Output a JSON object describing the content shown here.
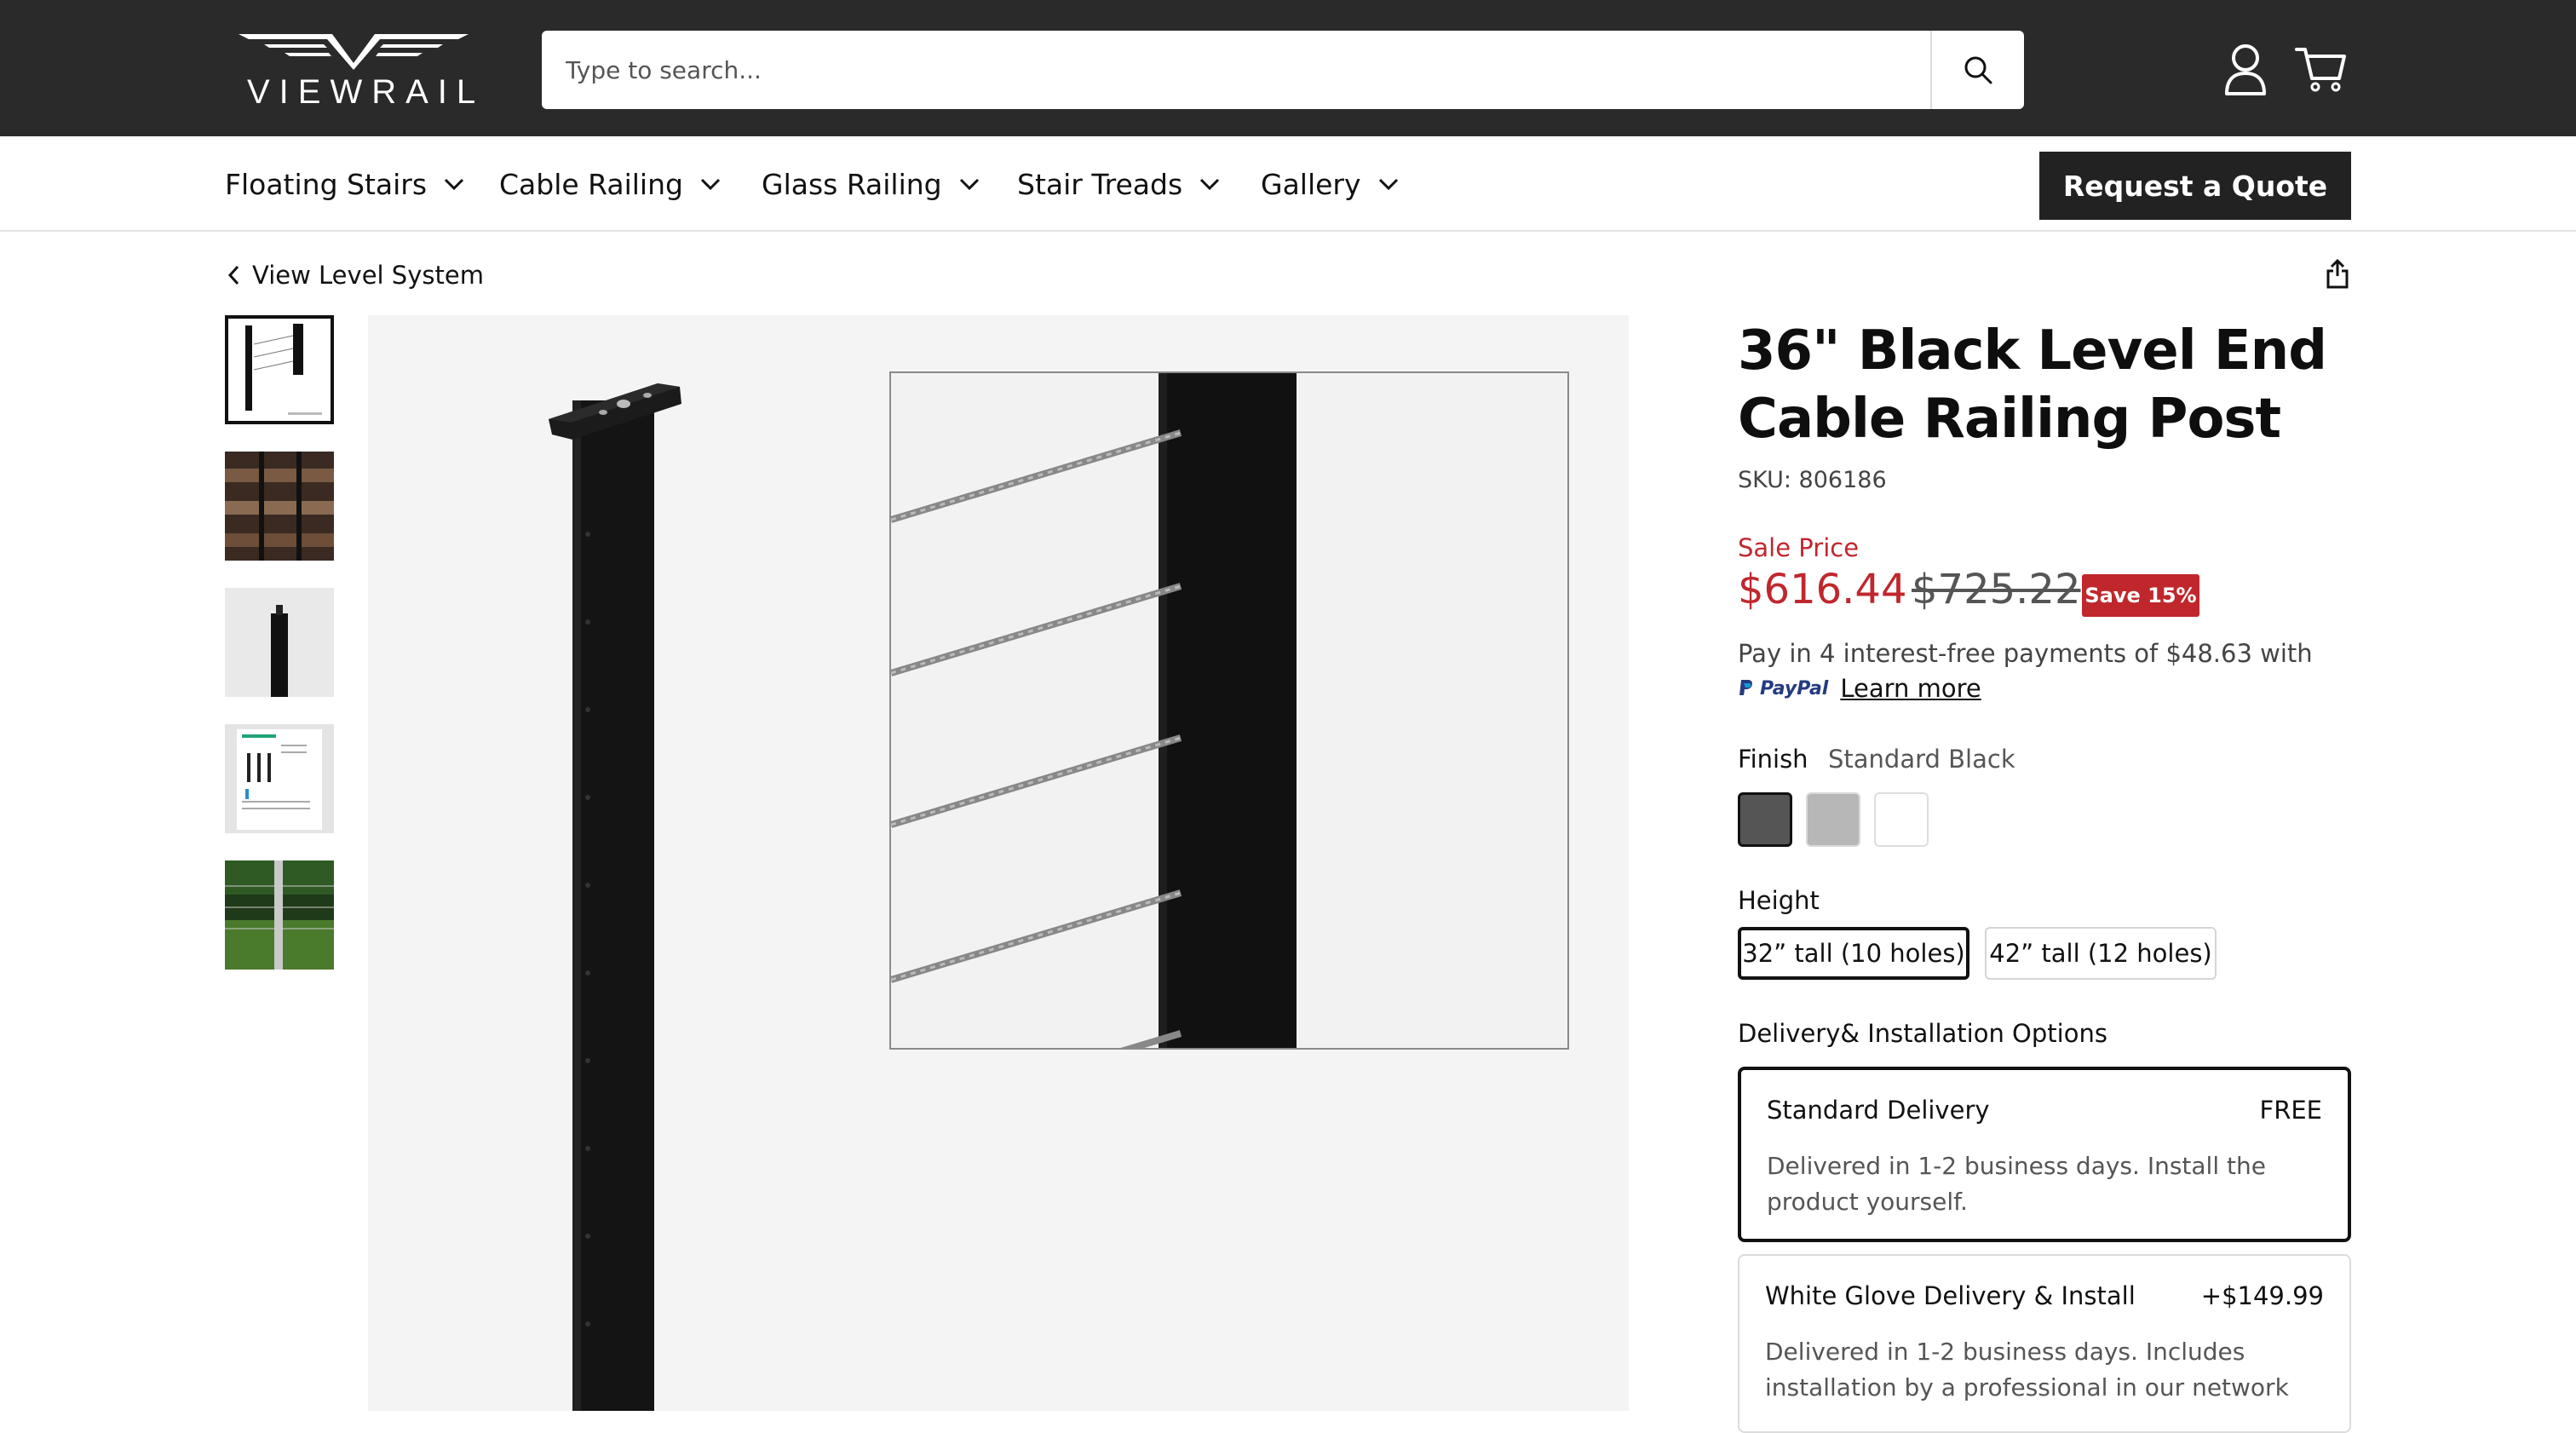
{
  "header": {
    "logo_text": "VIEWRAIL",
    "search_placeholder": "Type to search..."
  },
  "nav": {
    "items": [
      {
        "label": "Floating Stairs"
      },
      {
        "label": "Cable Railing"
      },
      {
        "label": "Glass Railing"
      },
      {
        "label": "Stair Treads"
      },
      {
        "label": "Gallery"
      }
    ],
    "quote_button": "Request a Quote"
  },
  "breadcrumb": {
    "back_label": "View Level System"
  },
  "product": {
    "title": "36\" Black Level End Cable Railing Post",
    "sku": "SKU: 806186",
    "sale_label": "Sale Price",
    "price": "$616.44",
    "old_price": "$725.22",
    "save_badge": "Save 15%",
    "paypal_text": "Pay in 4 interest-free payments of $48.63 with",
    "paypal_brand": "PayPal",
    "learn_more": "Learn more",
    "finish": {
      "label": "Finish",
      "selected": "Standard Black",
      "swatches": [
        "#555555",
        "#b7b7b7",
        "#ffffff"
      ]
    },
    "height": {
      "label": "Height",
      "options": [
        "32” tall (10 holes)",
        "42” tall (12 holes)"
      ],
      "selected_index": 0
    },
    "delivery": {
      "label": "Delivery& Installation Options",
      "options": [
        {
          "title": "Standard Delivery",
          "price": "FREE",
          "desc": "Delivered in 1-2 business days. Install the product yourself."
        },
        {
          "title": "White Glove Delivery & Install",
          "price": "+$149.99",
          "desc": "Delivered in 1-2 business days. Includes installation by a professional in our network"
        }
      ]
    }
  },
  "colors": {
    "header_bg": "#2a2a2a",
    "sale_red": "#c0272d"
  }
}
